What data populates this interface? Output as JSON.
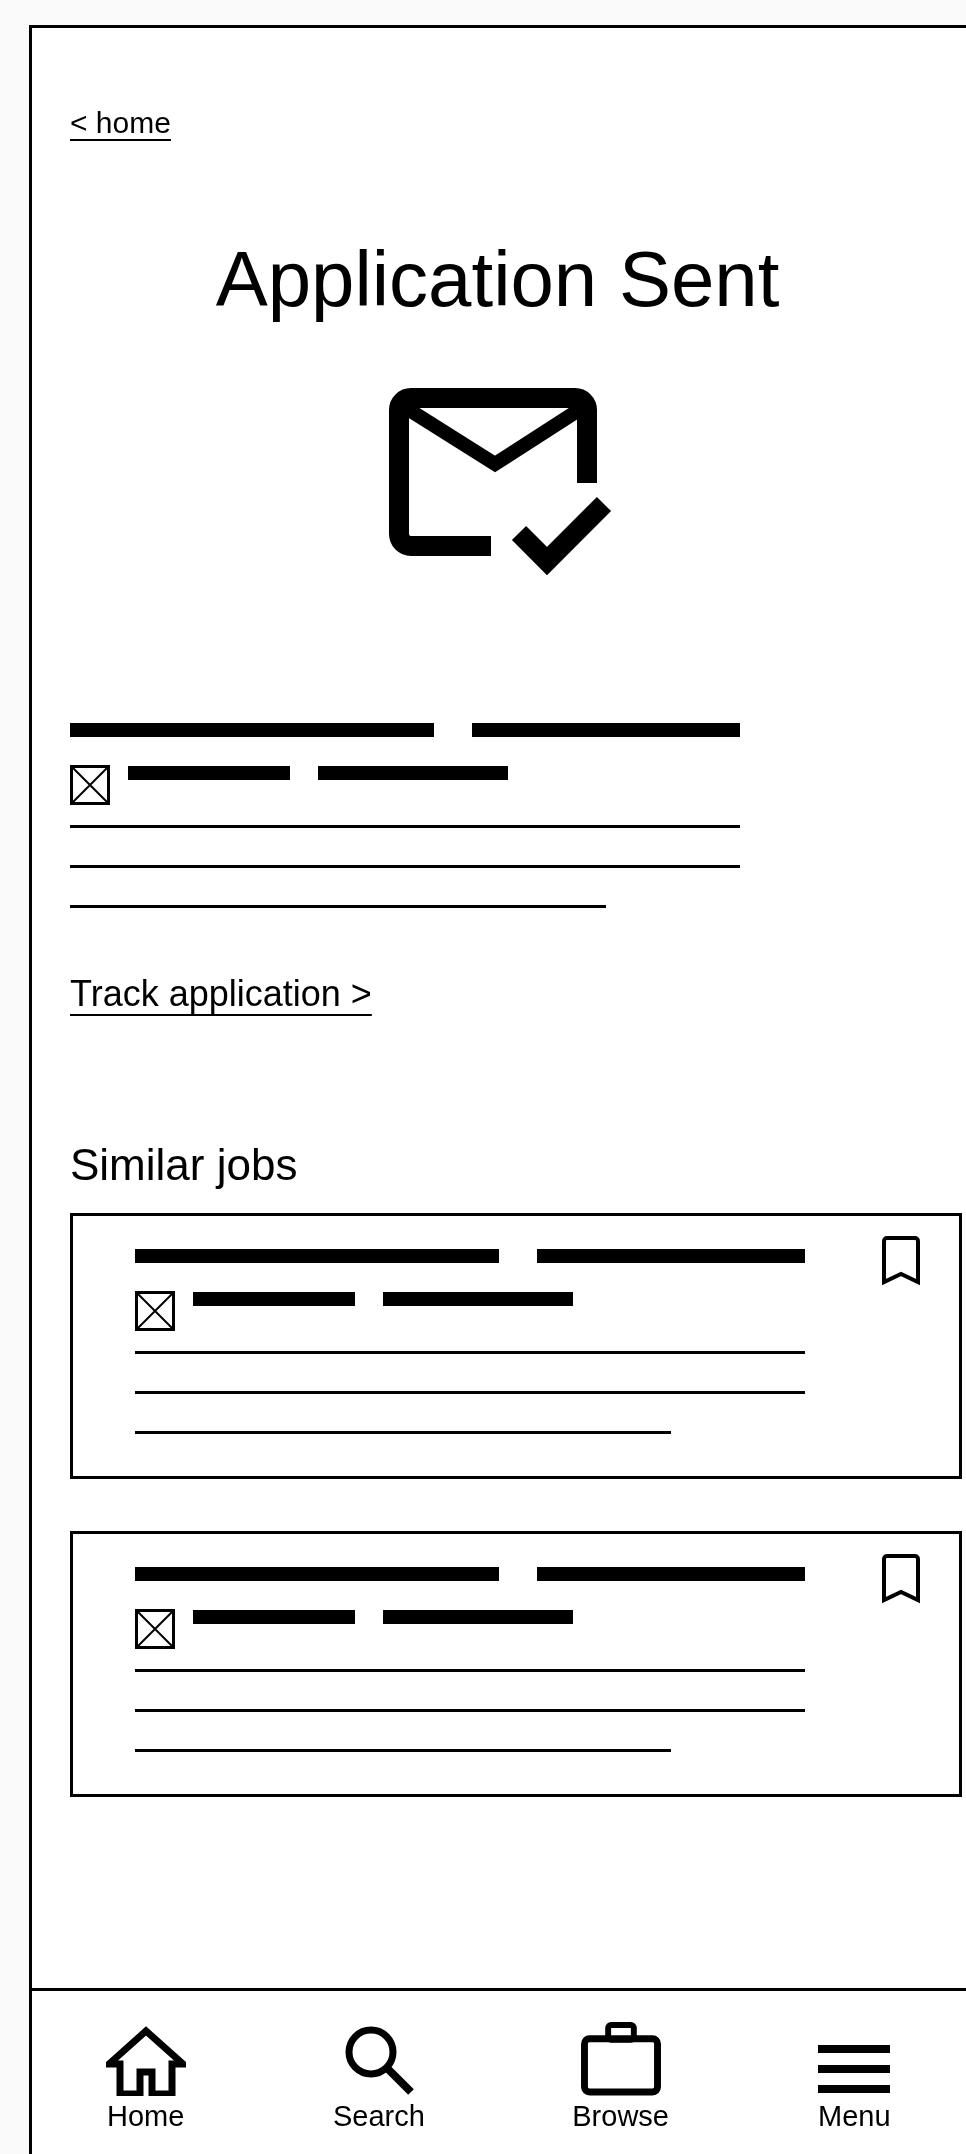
{
  "back_link": "< home",
  "title": "Application Sent",
  "track_link": "Track application >",
  "similar_jobs": {
    "heading": "Similar jobs",
    "cards": [
      {
        "bookmarked": false
      },
      {
        "bookmarked": false
      }
    ]
  },
  "bottom_nav": [
    {
      "kind": "home",
      "label": "Home"
    },
    {
      "kind": "search",
      "label": "Search"
    },
    {
      "kind": "browse",
      "label": "Browse"
    },
    {
      "kind": "menu",
      "label": "Menu"
    }
  ]
}
